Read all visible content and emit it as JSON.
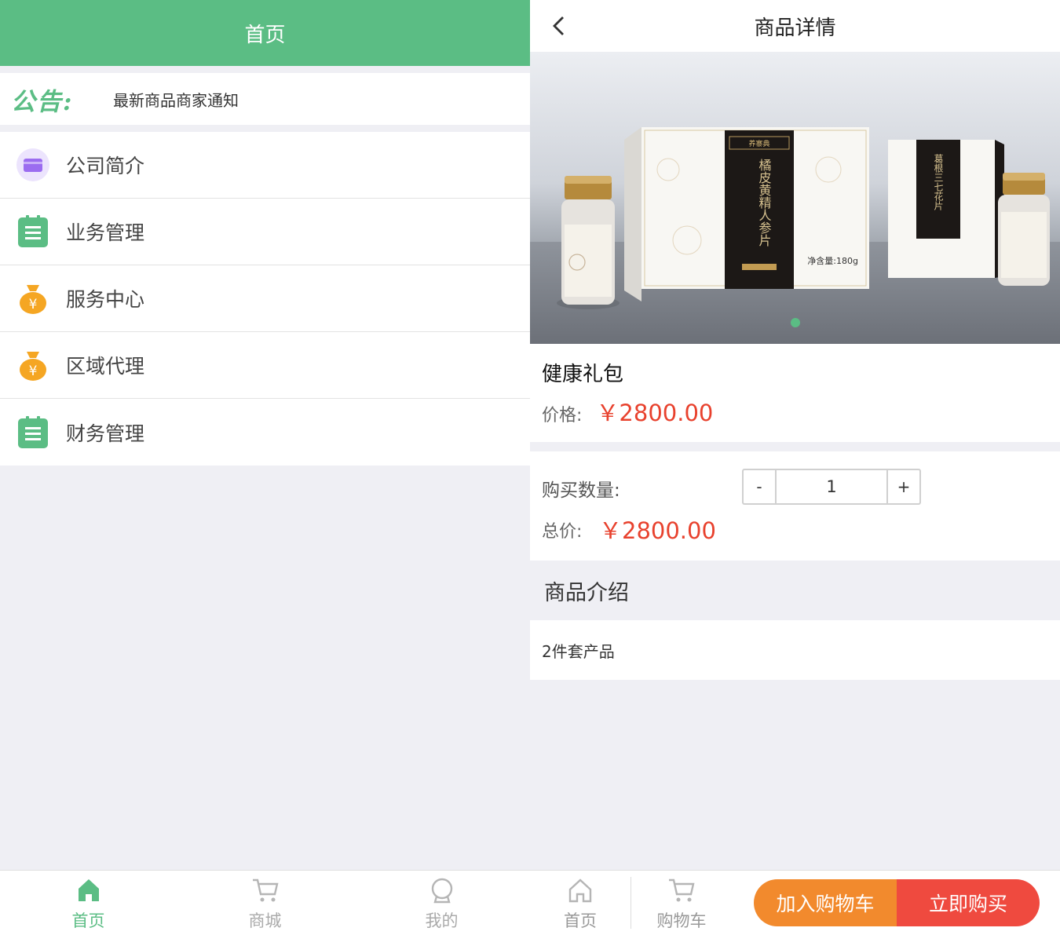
{
  "left": {
    "header_title": "首页",
    "notice": {
      "tag": "公告:",
      "text": "最新商品商家通知"
    },
    "menu": [
      {
        "label": "公司简介",
        "icon": "card-icon"
      },
      {
        "label": "业务管理",
        "icon": "clipboard-icon"
      },
      {
        "label": "服务中心",
        "icon": "money-bag-icon"
      },
      {
        "label": "区域代理",
        "icon": "money-bag-icon"
      },
      {
        "label": "财务管理",
        "icon": "clipboard-icon"
      }
    ],
    "tabbar": [
      {
        "label": "首页",
        "icon": "home-icon",
        "active": true
      },
      {
        "label": "商城",
        "icon": "cart-icon",
        "active": false
      },
      {
        "label": "我的",
        "icon": "user-icon",
        "active": false
      }
    ]
  },
  "right": {
    "header_title": "商品详情",
    "banner": {
      "box_large_title": "橘皮黄精人参片",
      "box_large_weight": "净含量:180g",
      "box_small_title": "葛根三七花片"
    },
    "product": {
      "name": "健康礼包",
      "price_label": "价格:",
      "price": "￥2800.00"
    },
    "purchase": {
      "qty_label": "购买数量:",
      "minus": "-",
      "qty": "1",
      "plus": "+",
      "total_label": "总价:",
      "total": "￥2800.00"
    },
    "intro": {
      "heading": "商品介绍",
      "body": "2件套产品"
    },
    "bottom": {
      "home_label": "首页",
      "cart_label": "购物车",
      "add_cart_label": "加入购物车",
      "buy_label": "立即购买"
    }
  },
  "colors": {
    "brand_green": "#5bbd84",
    "price_red": "#e8412d",
    "cart_orange": "#f28a2d",
    "buy_red": "#ef4a3f",
    "menu_purple": "#9b6cf0",
    "menu_gold": "#f5a623"
  }
}
